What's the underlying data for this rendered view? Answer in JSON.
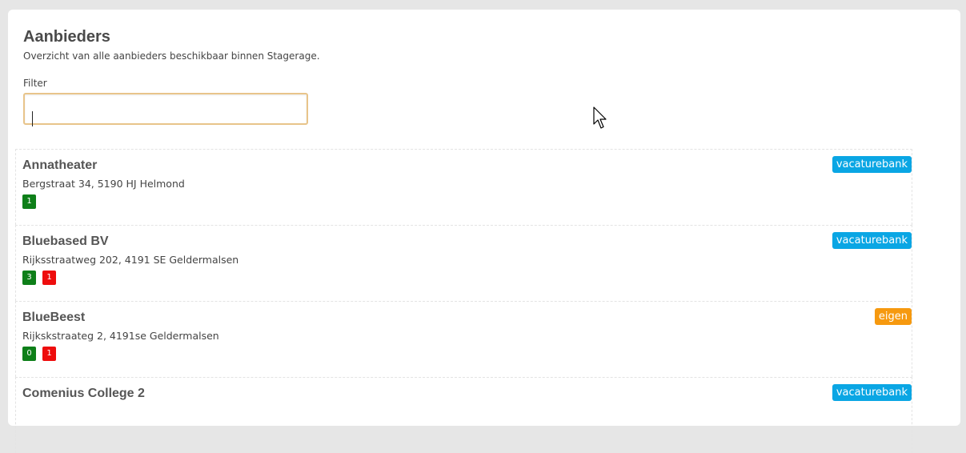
{
  "header": {
    "title": "Aanbieders",
    "subtitle": "Overzicht van alle aanbieders beschikbaar binnen Stagerage."
  },
  "filter": {
    "label": "Filter",
    "value": "",
    "placeholder": ""
  },
  "providers": [
    {
      "name": "Annatheater",
      "address": "Bergstraat 34, 5190 HJ Helmond",
      "counts": [
        {
          "value": "1",
          "status": "green"
        }
      ],
      "type": "vacaturebank"
    },
    {
      "name": "Bluebased BV",
      "address": "Rijksstraatweg 202, 4191 SE Geldermalsen",
      "counts": [
        {
          "value": "3",
          "status": "green"
        },
        {
          "value": "1",
          "status": "red"
        }
      ],
      "type": "vacaturebank"
    },
    {
      "name": "BlueBeest",
      "address": "Rijkskstraateg 2, 4191se Geldermalsen",
      "counts": [
        {
          "value": "0",
          "status": "green"
        },
        {
          "value": "1",
          "status": "red"
        }
      ],
      "type": "eigen"
    },
    {
      "name": "Comenius College 2",
      "address": "",
      "counts": [],
      "type": "vacaturebank"
    }
  ],
  "colors": {
    "vacaturebank": "#0aa6e4",
    "eigen": "#f6990f",
    "count_green": "#0e7f19",
    "count_red": "#ee0d0d",
    "input_focus_border": "#e8c48a"
  },
  "icons": {
    "mouse_cursor": "arrow-pointer-icon"
  }
}
